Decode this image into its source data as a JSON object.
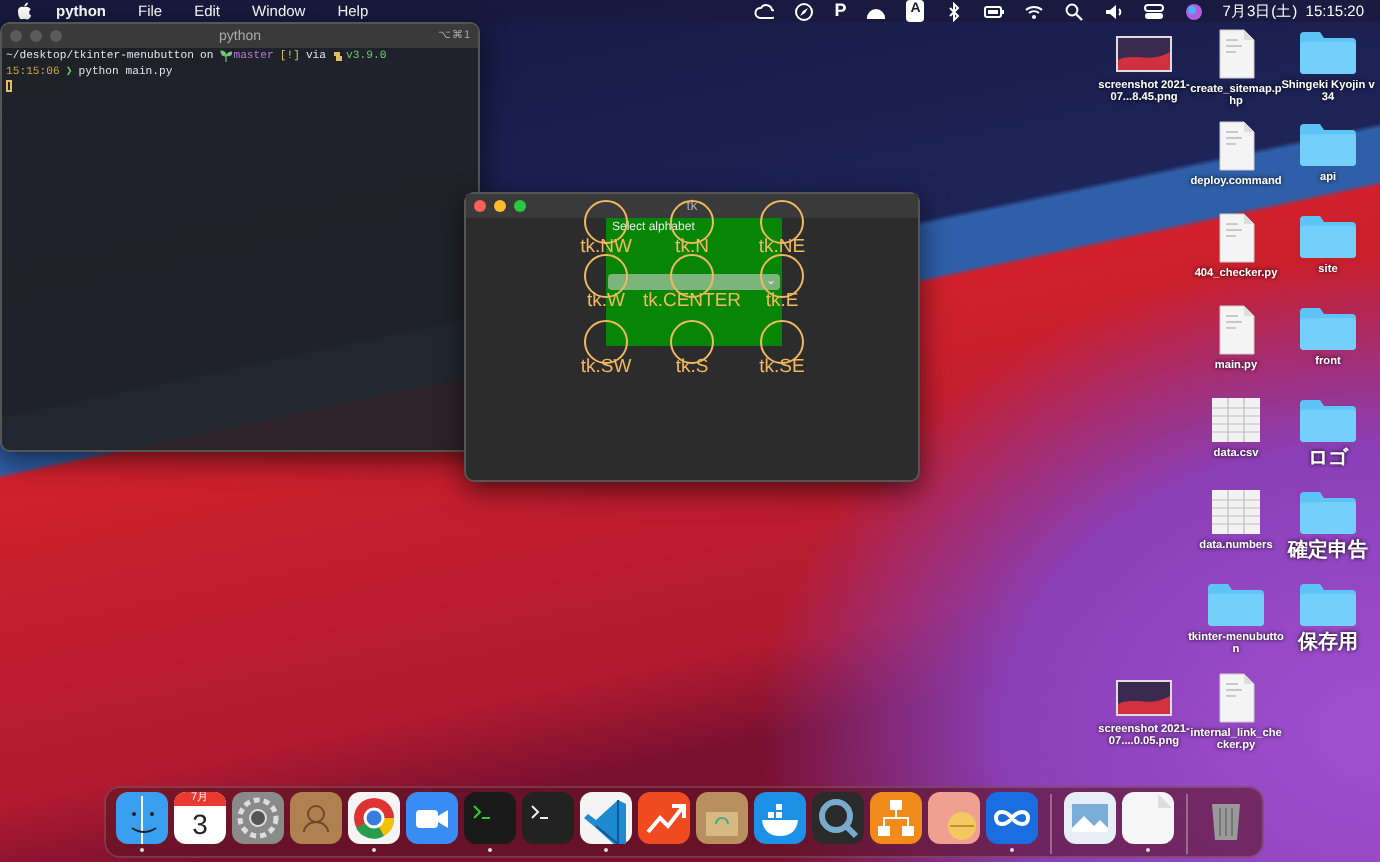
{
  "menu_bar": {
    "app_name": "python",
    "menus": [
      "File",
      "Edit",
      "Window",
      "Help"
    ],
    "status_items": [
      {
        "kind": "cloud"
      },
      {
        "kind": "compass"
      },
      {
        "kind": "text",
        "text": "P"
      },
      {
        "kind": "dome"
      },
      {
        "kind": "boxtext",
        "text": "A"
      },
      {
        "kind": "bluetooth"
      },
      {
        "kind": "battery"
      },
      {
        "kind": "wifi"
      },
      {
        "kind": "search"
      },
      {
        "kind": "speaker"
      },
      {
        "kind": "switch"
      },
      {
        "kind": "orb"
      }
    ],
    "clock": "7月3日(土)  15:15:20"
  },
  "terminal": {
    "title": "python",
    "shortcut": "⌥⌘1",
    "active": false,
    "lines": [
      [
        {
          "kind": "path",
          "text": "~/desktop/tkinter-menubutton"
        },
        {
          "kind": "plain",
          "text": "on"
        },
        {
          "kind": "branch",
          "text": "master"
        },
        {
          "kind": "flag",
          "text": "[!]"
        },
        {
          "kind": "plain",
          "text": "via"
        },
        {
          "kind": "version",
          "text": "v3.9.0"
        }
      ],
      [
        {
          "kind": "time",
          "text": "15:15:06"
        },
        {
          "kind": "prompt",
          "text": "❯"
        },
        {
          "kind": "plain",
          "text": "python main.py"
        }
      ]
    ]
  },
  "tk_window": {
    "title": "tk",
    "active": true,
    "label": "Select alphabet",
    "dropdown": {
      "caret": "⌄"
    },
    "anchors": [
      "tk.NW",
      "tk.N",
      "tk.NE",
      "tk.W",
      "tk.CENTER",
      "tk.E",
      "tk.SW",
      "tk.S",
      "tk.SE"
    ]
  },
  "desktop_icons": [
    [
      {
        "kind": "image",
        "label": "screenshot 2021-07...8.45.png"
      },
      {
        "kind": "image",
        "label": "screenshot 2021-07....0.05.png"
      }
    ],
    [
      {
        "kind": "file",
        "label": "create_sitemap.php"
      },
      {
        "kind": "file",
        "label": "deploy.command"
      },
      {
        "kind": "file",
        "label": "404_checker.py"
      },
      {
        "kind": "file",
        "label": "main.py"
      },
      {
        "kind": "sheet",
        "label": "data.csv"
      },
      {
        "kind": "sheet",
        "label": "data.numbers"
      },
      {
        "kind": "folder",
        "label": "tkinter-menubutton"
      },
      {
        "kind": "file",
        "label": "internal_link_checker.py"
      }
    ],
    [
      {
        "kind": "folder",
        "label": "Shingeki Kyojin v34"
      },
      {
        "kind": "folder",
        "label": "api"
      },
      {
        "kind": "folder",
        "label": "site"
      },
      {
        "kind": "folder",
        "label": "front"
      },
      {
        "kind": "folder",
        "label": "ロゴ"
      },
      {
        "kind": "folder",
        "label": "確定申告"
      },
      {
        "kind": "folder",
        "label": "保存用"
      }
    ]
  ],
  "dock": [
    {
      "kind": "face",
      "running": true
    },
    {
      "kind": "calendar",
      "running": false,
      "month": "7月",
      "day": "3"
    },
    {
      "kind": "gear",
      "running": false
    },
    {
      "kind": "contacts",
      "running": false
    },
    {
      "kind": "ring",
      "running": true
    },
    {
      "kind": "camera",
      "running": false
    },
    {
      "kind": "console",
      "running": true
    },
    {
      "kind": "terminal",
      "running": false
    },
    {
      "kind": "ribbon",
      "running": true
    },
    {
      "kind": "trend",
      "running": false
    },
    {
      "kind": "crate",
      "running": false
    },
    {
      "kind": "whale",
      "running": false
    },
    {
      "kind": "magnifier",
      "running": false
    },
    {
      "kind": "flowchart",
      "running": false
    },
    {
      "kind": "pill",
      "running": false
    },
    {
      "kind": "infinity",
      "running": true
    },
    {
      "kind": "separator"
    },
    {
      "kind": "photo",
      "running": false
    },
    {
      "kind": "document",
      "running": true
    },
    {
      "kind": "separator"
    },
    {
      "kind": "trash",
      "running": false
    }
  ]
}
